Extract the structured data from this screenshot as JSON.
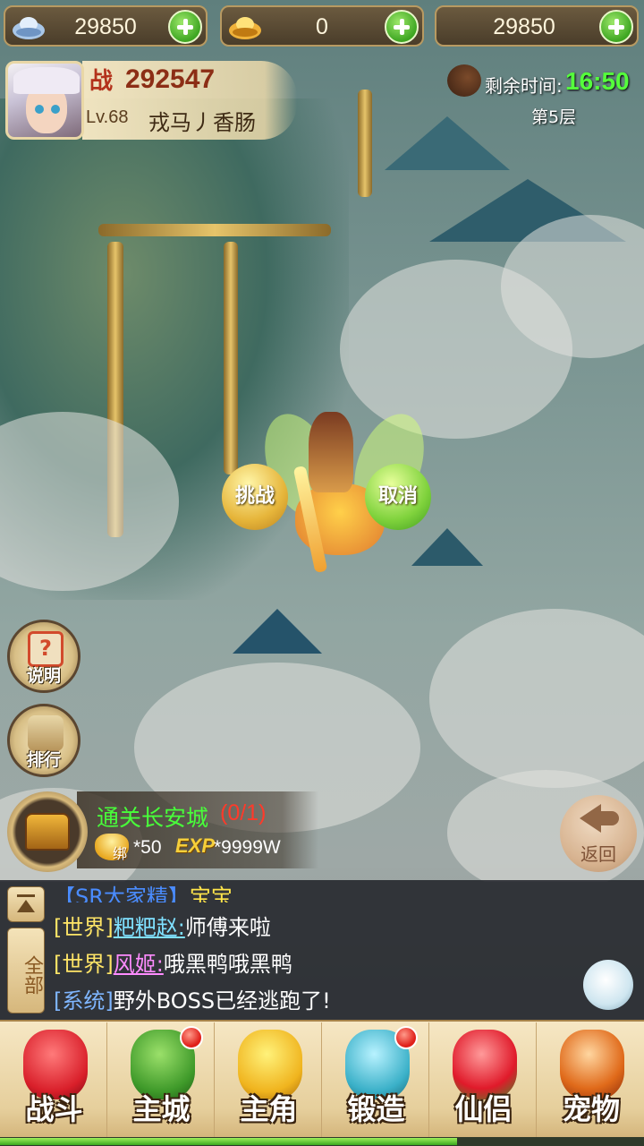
{
  "resources": [
    {
      "icon": "silver-ingot-icon",
      "value": "29850"
    },
    {
      "icon": "gold-ingot-icon",
      "value": "0"
    },
    {
      "icon": "bound-currency-icon",
      "value": "29850"
    }
  ],
  "player": {
    "power_icon_glyph": "战",
    "power": "292547",
    "level": "Lv.68",
    "name": "戎马丿香肠"
  },
  "timer": {
    "label": "剩余时间:",
    "value": "16:50",
    "floor": "第5层"
  },
  "battle": {
    "challenge_label": "挑战",
    "cancel_label": "取消"
  },
  "side_buttons": {
    "help_label": "说明",
    "rank_label": "排行"
  },
  "quest": {
    "title": "通关长安城",
    "progress": "(0/1)",
    "bound_tag": "绑",
    "reward_gold": "*50",
    "exp_icon_text": "EXP",
    "reward_exp": "*9999W"
  },
  "back_label": "返回",
  "chat": {
    "channel_label": "全部",
    "messages": [
      {
        "prefix": "【SR大家精】",
        "sender": "宝宝",
        "text": ""
      },
      {
        "prefix": "[世界]",
        "sender": "粑粑赵:",
        "text": "师傅来啦"
      },
      {
        "prefix": "[世界]",
        "sender": "风姬:",
        "text": "哦黑鸭哦黑鸭"
      },
      {
        "prefix": "[系统]",
        "sender": "",
        "text": "野外BOSS已经逃跑了!"
      }
    ]
  },
  "nav": [
    {
      "label": "战斗",
      "icon": "red-fighter-icon",
      "badge": false
    },
    {
      "label": "主城",
      "icon": "green-city-icon",
      "badge": true
    },
    {
      "label": "主角",
      "icon": "yellow-hero-icon",
      "badge": false
    },
    {
      "label": "锻造",
      "icon": "hammer-icon",
      "badge": true
    },
    {
      "label": "仙侣",
      "icon": "heart-companion-icon",
      "badge": false
    },
    {
      "label": "宠物",
      "icon": "monkey-pet-icon",
      "badge": false
    }
  ],
  "nav_progress": 0.71,
  "colors": {
    "accent_green": "#55ff3c",
    "quest_green": "#48ff3a",
    "progress_red": "#ff3a2a",
    "panel_gold": "#e6cf9c"
  }
}
